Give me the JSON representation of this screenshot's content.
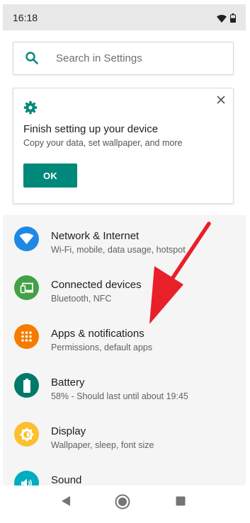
{
  "status_bar": {
    "time": "16:18",
    "icons": [
      "wifi-icon",
      "battery-icon"
    ]
  },
  "search": {
    "placeholder": "Search in Settings",
    "icon": "search-icon"
  },
  "suggestion_card": {
    "icon": "gear-icon",
    "close_icon": "close-icon",
    "title": "Finish setting up your device",
    "subtitle": "Copy your data, set wallpaper, and more",
    "button_label": "OK"
  },
  "settings_list": {
    "items": [
      {
        "title": "Network & Internet",
        "subtitle": "Wi-Fi, mobile, data usage, hotspot",
        "icon": "wifi-icon",
        "color": "#1e88e5"
      },
      {
        "title": "Connected devices",
        "subtitle": "Bluetooth, NFC",
        "icon": "devices-icon",
        "color": "#43a047"
      },
      {
        "title": "Apps & notifications",
        "subtitle": "Permissions, default apps",
        "icon": "apps-icon",
        "color": "#f57c00"
      },
      {
        "title": "Battery",
        "subtitle": "58% - Should last until about 19:45",
        "icon": "battery-icon",
        "color": "#00796b"
      },
      {
        "title": "Display",
        "subtitle": "Wallpaper, sleep, font size",
        "icon": "brightness-icon",
        "color": "#fbc02d"
      },
      {
        "title": "Sound",
        "subtitle": "",
        "icon": "volume-icon",
        "color": "#00acc1"
      }
    ]
  },
  "annotation": {
    "icon": "red-arrow-icon",
    "color": "#e8202a"
  },
  "nav_bar": {
    "icons": [
      "back-icon",
      "home-icon",
      "recents-icon"
    ]
  },
  "colors": {
    "accent": "#00897b"
  }
}
